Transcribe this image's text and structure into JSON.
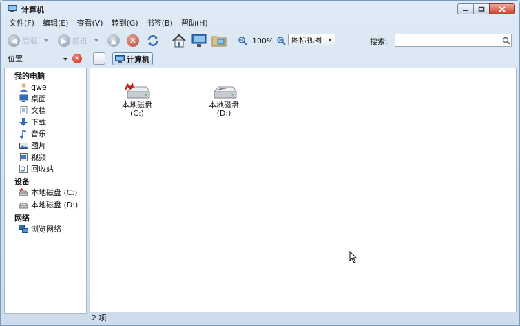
{
  "window": {
    "title": "计算机"
  },
  "menu": [
    {
      "label": "文件(F)"
    },
    {
      "label": "编辑(E)"
    },
    {
      "label": "查看(V)"
    },
    {
      "label": "转到(G)"
    },
    {
      "label": "书签(B)"
    },
    {
      "label": "帮助(H)"
    }
  ],
  "toolbar": {
    "back_label": "后退",
    "forward_label": "前进",
    "zoom_level": "100%",
    "view_mode": "图标视图",
    "search_label": "搜索:",
    "search_value": ""
  },
  "location": {
    "places_label": "位置",
    "crumb_label": "计算机"
  },
  "sidebar": {
    "sections": [
      {
        "title": "我的电脑",
        "items": [
          {
            "label": "qwe",
            "icon": "user-icon"
          },
          {
            "label": "桌面",
            "icon": "desktop-icon"
          },
          {
            "label": "文档",
            "icon": "documents-icon"
          },
          {
            "label": "下载",
            "icon": "download-icon"
          },
          {
            "label": "音乐",
            "icon": "music-icon"
          },
          {
            "label": "图片",
            "icon": "pictures-icon"
          },
          {
            "label": "视频",
            "icon": "video-icon"
          },
          {
            "label": "回收站",
            "icon": "trash-icon"
          }
        ]
      },
      {
        "title": "设备",
        "items": [
          {
            "label": "本地磁盘 (C:)",
            "icon": "system-drive-icon"
          },
          {
            "label": "本地磁盘 (D:)",
            "icon": "drive-icon"
          }
        ]
      },
      {
        "title": "网络",
        "items": [
          {
            "label": "浏览网络",
            "icon": "network-icon"
          }
        ]
      }
    ]
  },
  "main": {
    "drives": [
      {
        "name": "本地磁盘",
        "letter": "(C:)",
        "icon": "system-drive-icon"
      },
      {
        "name": "本地磁盘",
        "letter": "(D:)",
        "icon": "drive-icon"
      }
    ]
  },
  "status": {
    "text": "2 项"
  },
  "colors": {
    "accent": "#3a78b8",
    "close_red": "#c7452f",
    "frame": "#cddcec"
  }
}
